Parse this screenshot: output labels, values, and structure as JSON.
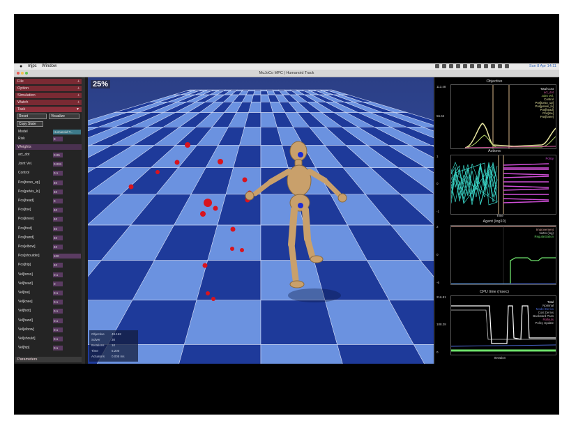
{
  "menubar": {
    "apple": "",
    "app_name": "mjpc",
    "window_menu": "Window",
    "clock": "Sun 8 Apr 14:11"
  },
  "window": {
    "title": "MuJoCo MPC | Humanoid Track"
  },
  "left_panel": {
    "sections": [
      "File",
      "Option",
      "Simulation",
      "Watch",
      "Task"
    ],
    "task_controls": {
      "reset_label": "Reset",
      "visualize_label": "Visualize",
      "copy_state_label": "Copy State",
      "model_label": "Model",
      "model_value": "Humanoid T...",
      "risk_label": "Risk",
      "risk_value": "0"
    },
    "weights_header": "Weights",
    "weights": [
      {
        "label": "act_dot",
        "value": "0.05"
      },
      {
        "label": "Joint Vel.",
        "value": "0.001"
      },
      {
        "label": "Control",
        "value": "0.1"
      },
      {
        "label": "Pos[torso_up]",
        "value": "40"
      },
      {
        "label": "Pos[pelvis_lo]",
        "value": "40"
      },
      {
        "label": "Pos[head]",
        "value": "0"
      },
      {
        "label": "Pos[toe]",
        "value": "40"
      },
      {
        "label": "Pos[knee]",
        "value": "40"
      },
      {
        "label": "Pos[foot]",
        "value": "40"
      },
      {
        "label": "Pos[hand]",
        "value": "40"
      },
      {
        "label": "Pos[elbow]",
        "value": "40"
      },
      {
        "label": "Pos[shoulder]",
        "value": "100"
      },
      {
        "label": "Pos[hip]",
        "value": "40"
      },
      {
        "label": "Vel[torso]",
        "value": "0.1"
      },
      {
        "label": "Vel[head]",
        "value": "0"
      },
      {
        "label": "Vel[toe]",
        "value": "0.1"
      },
      {
        "label": "Vel[knee]",
        "value": "0.1"
      },
      {
        "label": "Vel[foot]",
        "value": "0.1"
      },
      {
        "label": "Vel[hand]",
        "value": "0.1"
      },
      {
        "label": "Vel[elbow]",
        "value": "0.1"
      },
      {
        "label": "Vel[should]",
        "value": "0.1"
      },
      {
        "label": "Vel[hip]",
        "value": "0.1"
      }
    ],
    "parameters_header": "Parameters"
  },
  "scene": {
    "progress_label": "25%",
    "info": [
      {
        "label": "Objective",
        "value": "49.162"
      },
      {
        "label": "Solver",
        "value": "30"
      },
      {
        "label": "Iterations",
        "value": "10"
      },
      {
        "label": "Time",
        "value": "5.200"
      },
      {
        "label": "Actuators",
        "value": "0.005 ms"
      }
    ]
  },
  "right_panel": {
    "objective": {
      "title": "Objective",
      "y_top": "113.48",
      "y_mid": "56.62",
      "legend": [
        "Total Cost",
        "act_dot",
        "Joint Vel.",
        "Control",
        "Pos[torso_up]",
        "Pos[pelvis_lo]",
        "Pos[head]",
        "Pos[toe]",
        "Pos[knee]"
      ]
    },
    "actions": {
      "title": "Actions",
      "y_top": "1",
      "y_mid": "0",
      "y_bot": "-1",
      "legend": [
        "Policy",
        "Time"
      ],
      "x_label": "Time"
    },
    "agent": {
      "title": "Agent (log10)",
      "y_top": "2",
      "y_mid": "0",
      "y_bot": "-6",
      "legend": [
        "Improvement",
        "NaNs (log)",
        "Regularization"
      ]
    },
    "cpu": {
      "title": "CPU time (msec)",
      "y_top": "216.81",
      "y_mid": "108.28",
      "y_bot": "0",
      "legend": [
        "Total",
        "Nominal",
        "Model Derivs",
        "Cost Derivs",
        "Backward Pass",
        "Rollouts",
        "Policy Update"
      ],
      "x_label": "Iteration"
    },
    "colors": {
      "objective_line": "#e8e6a0",
      "policy": "#39d3c5",
      "nominal": "#d14fd9",
      "marker": "#d9b98a",
      "improvement": "#f2b8ae",
      "regularization": "#6ee06b",
      "cpu_total": "#ffffff",
      "cpu_green": "#6ee06b",
      "cpu_blue": "#4d6bd6"
    }
  }
}
